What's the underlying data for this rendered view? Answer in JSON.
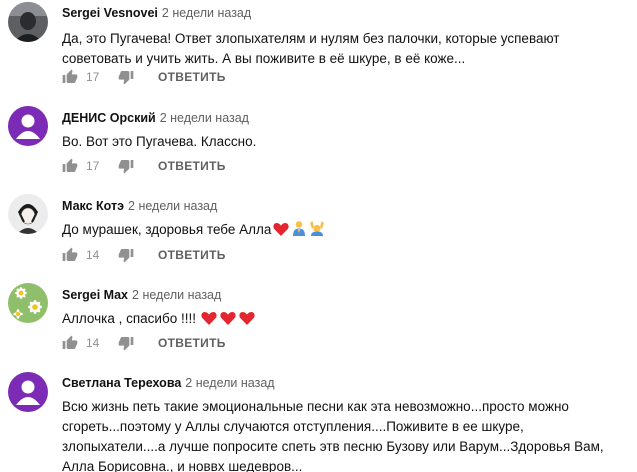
{
  "comments": [
    {
      "author": "Sergei Vesnovei",
      "time": "2 недели назад",
      "text": "Да, это Пугачева! Ответ злопыхателям и нулям без палочки, которые успевают советовать и учить жить. А вы поживите в её шкуре, в её коже...",
      "likes": "17",
      "reply": "ОТВЕТИТЬ",
      "avatar": "dark-photo"
    },
    {
      "author": "ДЕНИС Орский",
      "time": "2 недели назад",
      "text": "Во. Вот это Пугачева. Классно.",
      "likes": "17",
      "reply": "ОТВЕТИТЬ",
      "avatar": "purple-circle"
    },
    {
      "author": "Макс Котэ",
      "time": "2 недели назад",
      "text": "До мурашек, здоровья тебе Алла",
      "likes": "14",
      "reply": "ОТВЕТИТЬ",
      "avatar": "bw-character",
      "emojis": [
        "heart-emoji",
        "praying-emoji",
        "raised-hands-emoji"
      ]
    },
    {
      "author": "Sergei Max",
      "time": "2 недели назад",
      "text": "Аллочка , спасибо !!!!",
      "likes": "14",
      "reply": "ОТВЕТИТЬ",
      "avatar": "daisies-photo",
      "emojis": [
        "heart-emoji",
        "heart-emoji",
        "heart-emoji"
      ]
    },
    {
      "author": "Светлана Терехова",
      "time": "2 недели назад",
      "text": "Всю жизнь петь такие эмоциональные песни как эта невозможно...просто можно сгореть...поэтому у Аллы случаются отступления....Поживите в  ее шкуре, злопыхатели....а лучше попросите спеть этв песню  Бузову или Варум...Здоровья Вам, Алла Борисовна., и новвх шедевров...",
      "avatar": "purple-circle"
    }
  ],
  "colors": {
    "author": "#111111",
    "time": "#606060",
    "count": "#909090",
    "reply": "#606060",
    "avatar_purple": "#7b2bb5",
    "heart": "#e3262f"
  }
}
